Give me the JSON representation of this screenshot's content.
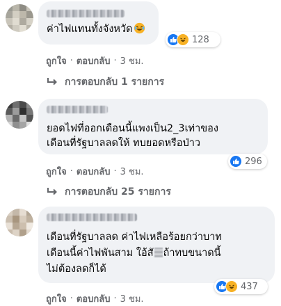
{
  "colors": {
    "bubble": "#f0f2f5",
    "secondary_text": "#65676b",
    "like_blue": "#1877f2",
    "haha_yellow": "#f7b125"
  },
  "comments": [
    {
      "name_blurred": true,
      "lines": [
        "ค่าไฟแทนทั้งจังหวัด"
      ],
      "inline_emoji": "laughing-face-icon",
      "reactions": [
        "like-icon",
        "haha-icon"
      ],
      "reaction_count": "128",
      "like_label": "ถูกใจ",
      "reply_label": "ตอบกลับ",
      "time": "3 ชม.",
      "replies_label": "การตอบกลับ 1 รายการ"
    },
    {
      "name_blurred": true,
      "lines": [
        "ยอดไฟที่ออกเดือนนี้แพงเป็น2_3เท่าของ",
        "เดือนที่รัฐบาลลดให้ ทบยอดหรือป่าว"
      ],
      "reactions": [
        "like-icon"
      ],
      "reaction_count": "296",
      "like_label": "ถูกใจ",
      "reply_label": "ตอบกลับ",
      "time": "3 ชม.",
      "replies_label": "การตอบกลับ 25 รายการ"
    },
    {
      "name_blurred": true,
      "lines": [
        "เดือนที่รัฐบาลลด ค่าไฟเหลือร้อยกว่าบาท",
        "ไม่ต้องลดก็ได้"
      ],
      "line2_before": "เดือนนี้ค่าไฟพันสาม ใอ้สั",
      "line2_after": "ถ้าทบขนาดนี้",
      "reactions": [
        "like-icon",
        "haha-icon"
      ],
      "reaction_count": "437",
      "like_label": "ถูกใจ",
      "reply_label": "ตอบกลับ",
      "time": "3 ชม."
    }
  ]
}
